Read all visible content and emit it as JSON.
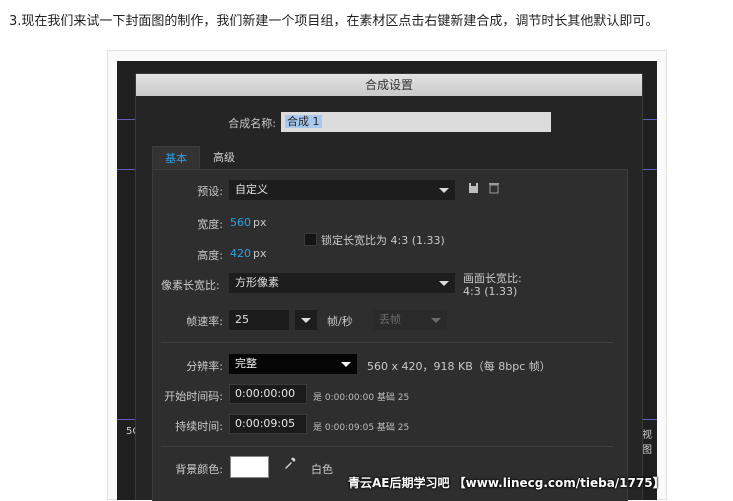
{
  "intro_text": "3.现在我们来试一下封面图的制作，我们新建一个项目组，在素材区点击右键新建合成，调节时长其他默认即可。",
  "background": {
    "left_text": "5C",
    "right_text": "视图"
  },
  "dialog": {
    "title": "合成设置",
    "name_label": "合成名称:",
    "name_value": "合成 1",
    "tabs": [
      {
        "label": "基本",
        "active": true
      },
      {
        "label": "高级",
        "active": false
      }
    ],
    "preset_label": "预设:",
    "preset_value": "自定义",
    "width_label": "宽度:",
    "width_value": "560",
    "width_unit": "px",
    "height_label": "高度:",
    "height_value": "420",
    "height_unit": "px",
    "lock_label": "锁定长宽比为 4:3 (1.33)",
    "pixel_aspect_label": "像素长宽比:",
    "pixel_aspect_value": "方形像素",
    "frame_aspect_label": "画面长宽比:",
    "frame_aspect_value": "4:3 (1.33)",
    "framerate_label": "帧速率:",
    "framerate_value": "25",
    "framerate_unit": "帧/秒",
    "drop_frame_value": "丢帧",
    "resolution_label": "分辨率:",
    "resolution_value": "完整",
    "resolution_info": "560 x 420，918 KB（每 8bpc 帧）",
    "start_tc_label": "开始时间码:",
    "start_tc_value": "0:00:00:00",
    "start_tc_info": "是 0:00:00:00  基础 25",
    "duration_label": "持续时间:",
    "duration_value": "0:00:09:05",
    "duration_info": "是 0:00:09:05  基础 25",
    "bg_color_label": "背景颜色:",
    "bg_color_name": "白色",
    "bg_color_hex": "#ffffff"
  },
  "watermark": "青云AE后期学习吧 【www.linecg.com/tieba/1775】"
}
